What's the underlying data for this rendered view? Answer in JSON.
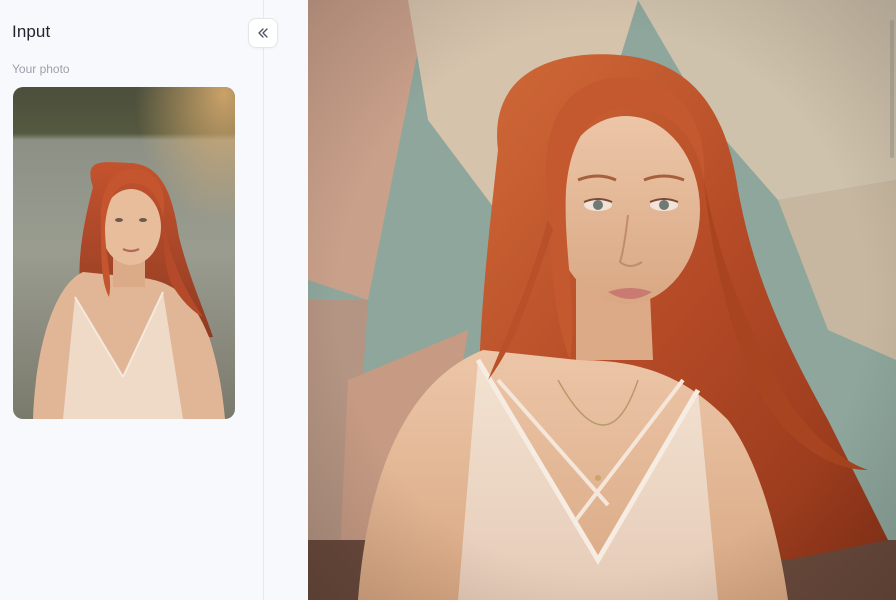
{
  "sidebar": {
    "title": "Input",
    "photo_label": "Your photo",
    "collapse_icon": "double-chevron-left-icon"
  },
  "thumbnail": {
    "description_icon": "input-photo"
  },
  "result": {
    "image_icon": "result-photo"
  },
  "colors": {
    "sidebar_bg": "#f8f9fc",
    "title_text": "#1f2430",
    "label_text": "#9aa1ad",
    "border": "#e6e8ee"
  }
}
